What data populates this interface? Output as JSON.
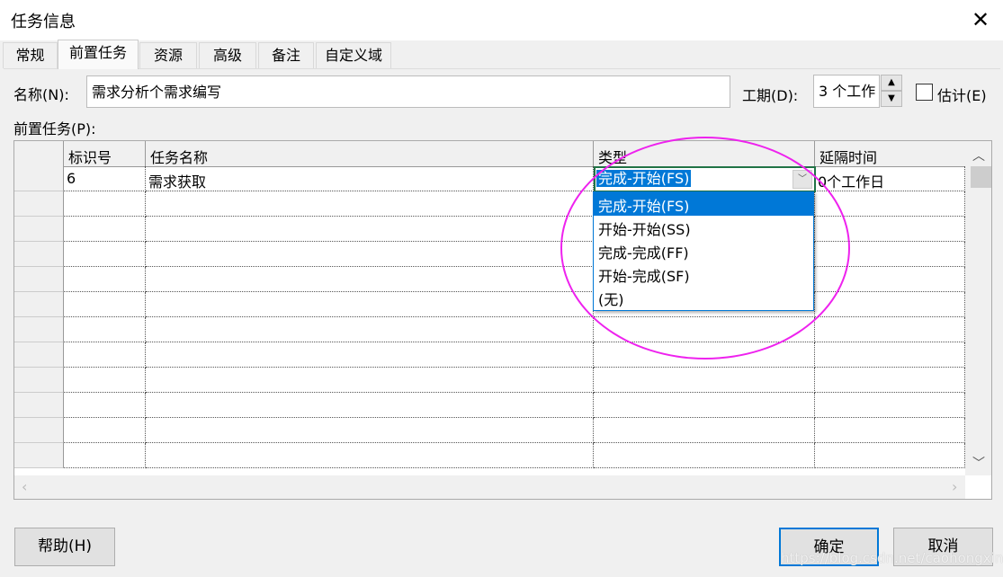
{
  "window": {
    "title": "任务信息",
    "close": "✕"
  },
  "tabs": [
    {
      "label": "常规"
    },
    {
      "label": "前置任务",
      "selected": true
    },
    {
      "label": "资源"
    },
    {
      "label": "高级"
    },
    {
      "label": "备注"
    },
    {
      "label": "自定义域"
    }
  ],
  "name_field": {
    "label": "名称(N):",
    "value": "需求分析个需求编写"
  },
  "duration_field": {
    "label": "工期(D):",
    "value": "3 个工作"
  },
  "estimate": {
    "label": "估计(E)",
    "checked": false
  },
  "predecessors": {
    "label": "前置任务(P):",
    "columns": [
      "标识号",
      "任务名称",
      "类型",
      "延隔时间"
    ],
    "rows": [
      {
        "id": "6",
        "name": "需求获取",
        "type": "完成-开始(FS)",
        "lag": "0个工作日"
      }
    ],
    "type_options": [
      "完成-开始(FS)",
      "开始-开始(SS)",
      "完成-完成(FF)",
      "开始-完成(SF)",
      "(无)"
    ],
    "selected_option": "完成-开始(FS)"
  },
  "buttons": {
    "help": "帮助(H)",
    "ok": "确定",
    "cancel": "取消"
  },
  "annotation_color": "#ee22ee",
  "accent": "#0078d7",
  "watermark": "https://blog.csdn.net/caohongxing"
}
